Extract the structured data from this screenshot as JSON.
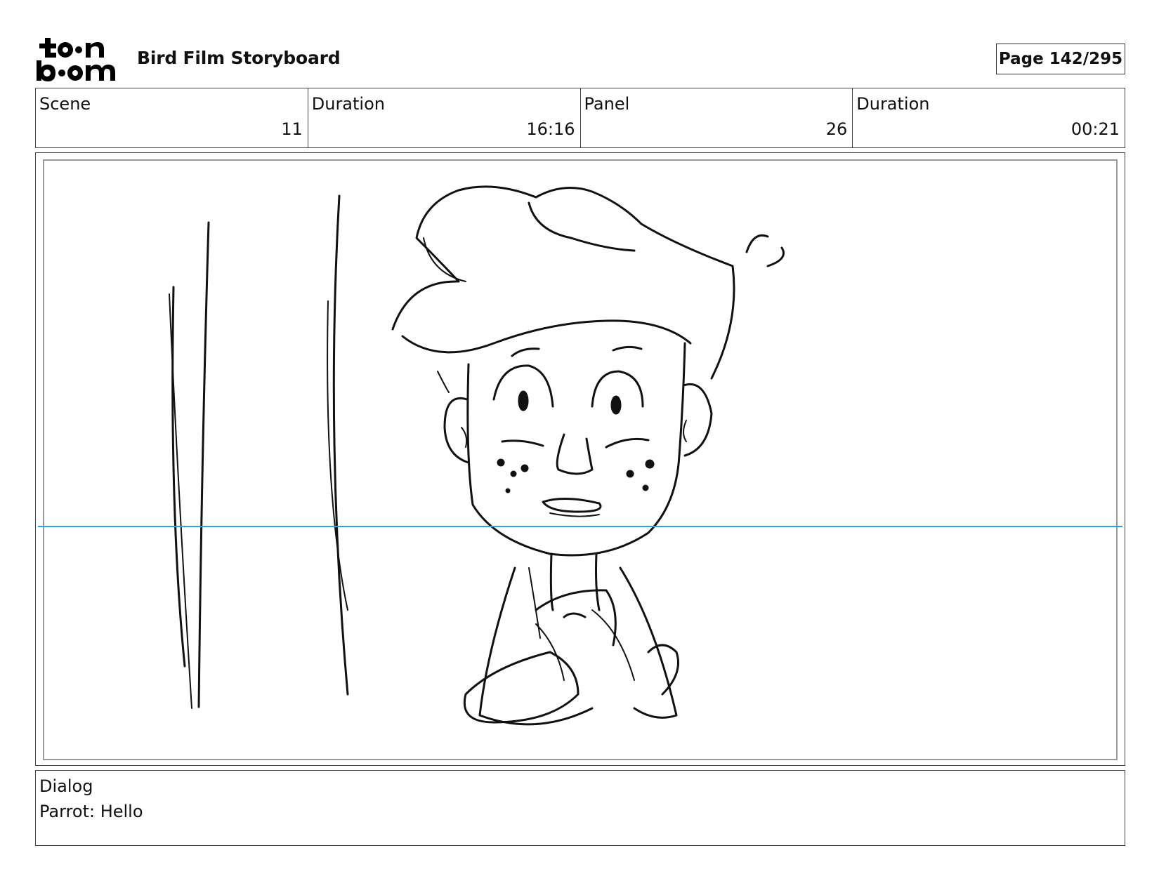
{
  "header": {
    "logo": {
      "icon": "toon-boom-logo",
      "text": "toon boom"
    },
    "title": "Bird Film Storyboard",
    "page": "Page 142/295"
  },
  "info": {
    "scene_label": "Scene",
    "scene_value": "11",
    "scene_duration_label": "Duration",
    "scene_duration_value": "16:16",
    "panel_label": "Panel",
    "panel_value": "26",
    "panel_duration_label": "Duration",
    "panel_duration_value": "00:21"
  },
  "panel": {
    "image": "sketch-boy-with-curly-hair-icon",
    "guide_color": "#2aa2e3"
  },
  "dialog": {
    "label": "Dialog",
    "text": "Parrot: Hello"
  }
}
